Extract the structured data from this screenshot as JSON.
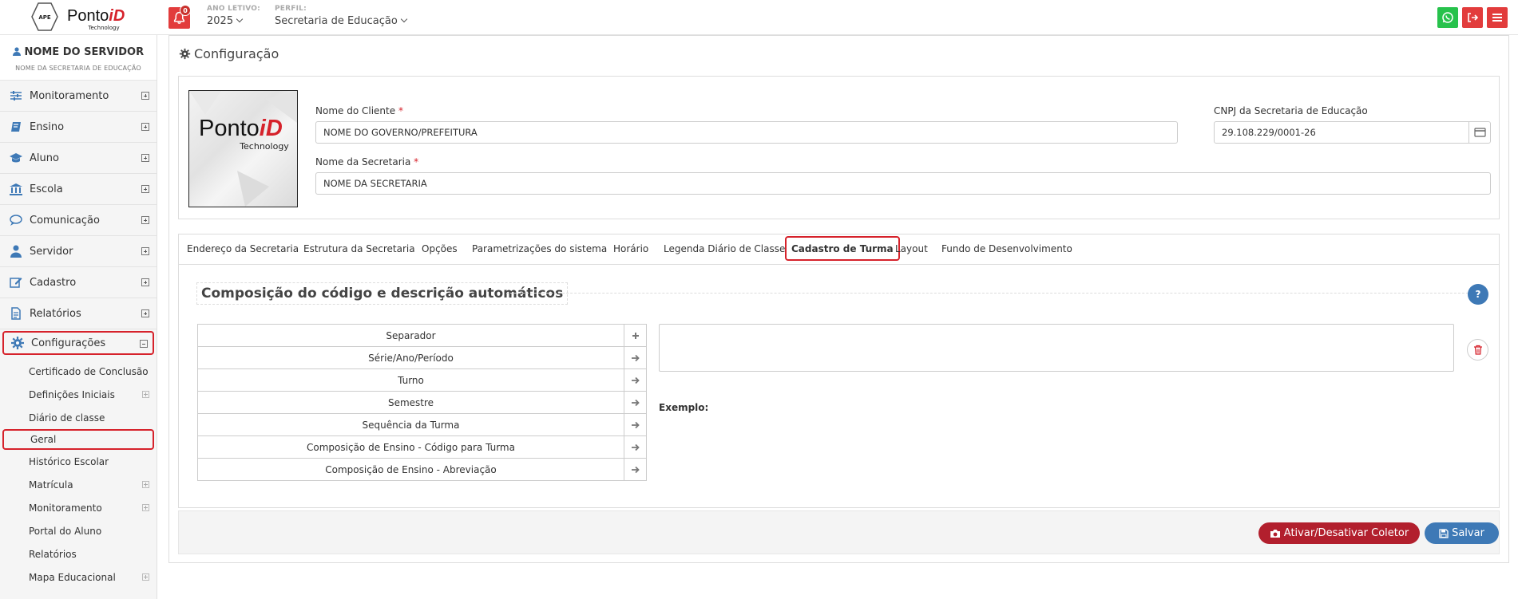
{
  "header": {
    "logo_badge": "APE",
    "logo_text_main": "Ponto",
    "logo_text_accent": "iD",
    "logo_text_sub": "Technology",
    "notification_count": "0",
    "ano_letivo_label": "ANO LETIVO:",
    "ano_letivo_value": "2025",
    "perfil_label": "PERFIL:",
    "perfil_value": "Secretaria de Educação"
  },
  "sidebar": {
    "user_name": "NOME DO SERVIDOR",
    "user_sub": "NOME DA SECRETARIA DE EDUCAÇÃO",
    "items": [
      {
        "label": "Monitoramento",
        "icon": "sliders-icon"
      },
      {
        "label": "Ensino",
        "icon": "book-icon"
      },
      {
        "label": "Aluno",
        "icon": "graduation-cap-icon"
      },
      {
        "label": "Escola",
        "icon": "bank-icon"
      },
      {
        "label": "Comunicação",
        "icon": "chat-bubble-icon"
      },
      {
        "label": "Servidor",
        "icon": "user-icon"
      },
      {
        "label": "Cadastro",
        "icon": "edit-icon"
      },
      {
        "label": "Relatórios",
        "icon": "file-icon"
      },
      {
        "label": "Configurações",
        "icon": "gear-icon"
      }
    ],
    "sub_items": [
      {
        "label": "Certificado de Conclusão"
      },
      {
        "label": "Definições Iniciais"
      },
      {
        "label": "Diário de classe"
      },
      {
        "label": "Geral"
      },
      {
        "label": "Histórico Escolar"
      },
      {
        "label": "Matrícula"
      },
      {
        "label": "Monitoramento"
      },
      {
        "label": "Portal do Aluno"
      },
      {
        "label": "Relatórios"
      },
      {
        "label": "Mapa Educacional"
      }
    ]
  },
  "main": {
    "title": "Configuração",
    "client": {
      "nome_cliente_label": "Nome do Cliente",
      "nome_cliente_value": "NOME DO GOVERNO/PREFEITURA",
      "cnpj_label": "CNPJ da Secretaria de Educação",
      "cnpj_value": "29.108.229/0001-26",
      "nome_secretaria_label": "Nome da Secretaria",
      "nome_secretaria_value": "NOME DA SECRETARIA",
      "required_mark": "*"
    },
    "tabs": [
      {
        "label": "Endereço da Secretaria"
      },
      {
        "label": "Estrutura da Secretaria"
      },
      {
        "label": "Opções"
      },
      {
        "label": "Parametrizações do sistema"
      },
      {
        "label": "Horário"
      },
      {
        "label": "Legenda Diário de Classe"
      },
      {
        "label": "Cadastro de Turma"
      },
      {
        "label": "Layout"
      },
      {
        "label": "Fundo de Desenvolvimento"
      }
    ],
    "section_title": "Composição do código e descrição automáticos",
    "help_label": "?",
    "components": [
      {
        "label": "Separador",
        "action": "plus-icon"
      },
      {
        "label": "Série/Ano/Período",
        "action": "arrow-right-icon"
      },
      {
        "label": "Turno",
        "action": "arrow-right-icon"
      },
      {
        "label": "Semestre",
        "action": "arrow-right-icon"
      },
      {
        "label": "Sequência da Turma",
        "action": "arrow-right-icon"
      },
      {
        "label": "Composição de Ensino - Código para Turma",
        "action": "arrow-right-icon"
      },
      {
        "label": "Composição de Ensino - Abreviação",
        "action": "arrow-right-icon"
      }
    ],
    "example_label": "Exemplo:"
  },
  "footer": {
    "coletor_label": "Ativar/Desativar Coletor",
    "salvar_label": "Salvar"
  },
  "colors": {
    "accent_red": "#d6222b",
    "whatsapp_green": "#27c24c",
    "save_blue": "#3e79b6",
    "coletor_red": "#b21f2d"
  }
}
